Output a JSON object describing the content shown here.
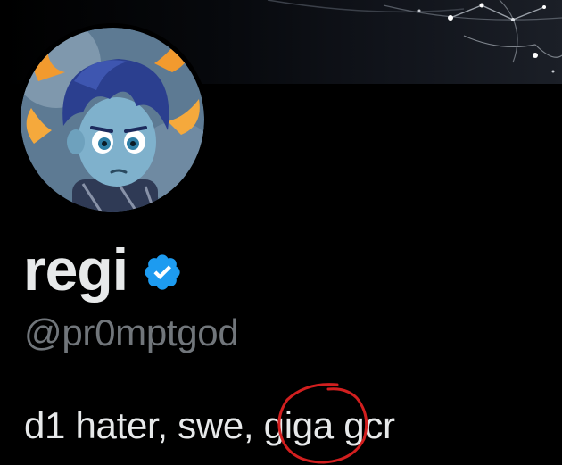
{
  "profile": {
    "display_name": "regi",
    "handle": "@pr0mptgod",
    "bio": "d1 hater, swe, giga gcr"
  },
  "icons": {
    "verified": "verified-badge-icon",
    "avatar": "cartoon-boy-avatar",
    "annotation": "red-hand-drawn-circle"
  },
  "colors": {
    "background": "#000000",
    "name": "#e7e9ea",
    "handle": "#71767b",
    "verified": "#1d9bf0",
    "annotation": "#d21f1f"
  }
}
